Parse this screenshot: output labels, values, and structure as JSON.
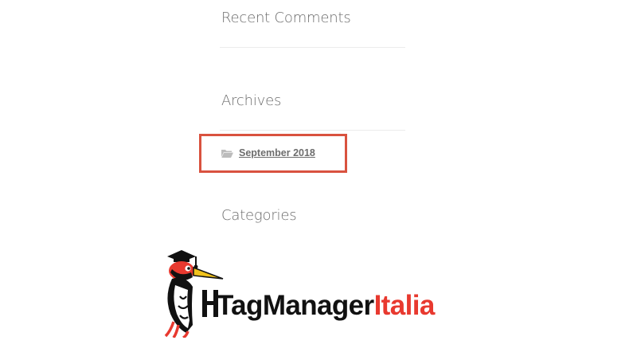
{
  "sidebar": {
    "recent_comments_title": "Recent Comments",
    "archives_title": "Archives",
    "archive_items": [
      {
        "label": "September 2018",
        "icon": "folder-open-icon"
      }
    ],
    "categories_title": "Categories"
  },
  "logo": {
    "brand_part1": "TagManager",
    "brand_part2": "Italia",
    "colors": {
      "dark": "#111111",
      "red": "#e8392f"
    }
  },
  "highlight_color": "#d9523f"
}
